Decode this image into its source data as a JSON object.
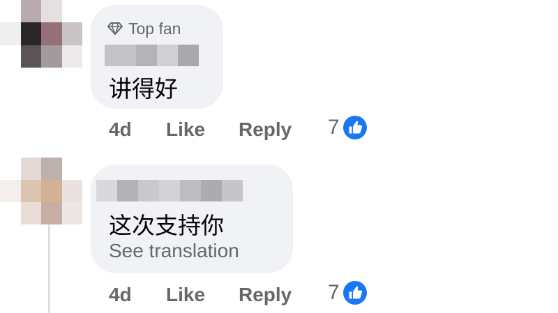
{
  "comments": [
    {
      "badge": "Top fan",
      "text": "讲得好",
      "see_translation": "",
      "time": "4d",
      "like_label": "Like",
      "reply_label": "Reply",
      "reaction_count": "7",
      "reaction_icon": "thumbs-up-icon"
    },
    {
      "badge": "",
      "text": "这次支持你",
      "see_translation": "See translation",
      "time": "4d",
      "like_label": "Like",
      "reply_label": "Reply",
      "reaction_count": "7",
      "reaction_icon": "thumbs-up-icon"
    }
  ],
  "colors": {
    "bubble": "#f0f2f5",
    "secondary_text": "#65676b",
    "like_blue": "#1877f2",
    "thread_line": "#dedfe3"
  }
}
